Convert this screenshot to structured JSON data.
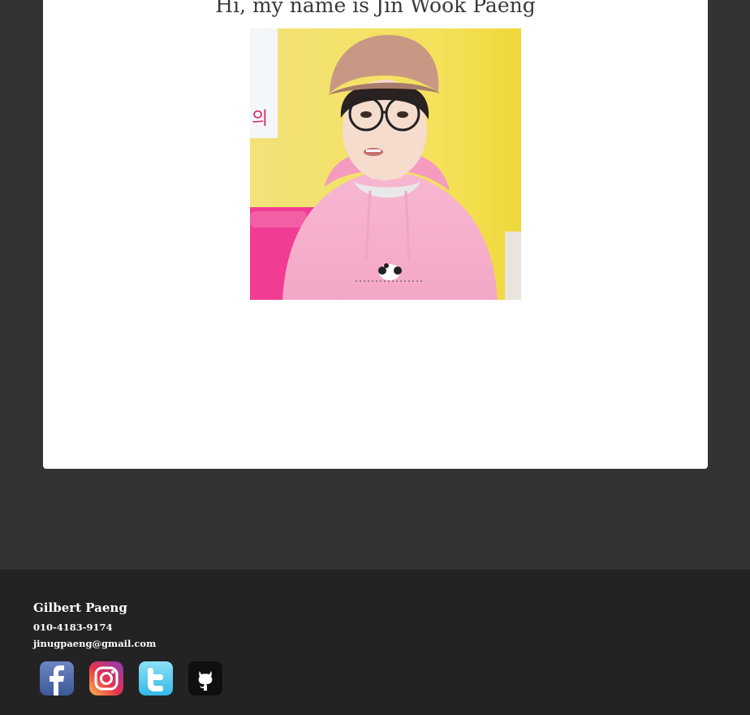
{
  "profile": {
    "heading": "Hi, my name is Jin Wook Paeng",
    "photo_alt": "Profile photo"
  },
  "footer": {
    "name": "Gilbert Paeng",
    "phone": "010-4183-9174",
    "email": "jinugpaeng@gmail.com"
  },
  "social": [
    {
      "name": "facebook",
      "icon": "facebook-icon"
    },
    {
      "name": "instagram",
      "icon": "instagram-icon"
    },
    {
      "name": "twitter",
      "icon": "twitter-icon"
    },
    {
      "name": "github",
      "icon": "github-icon"
    }
  ],
  "colors": {
    "page_bg": "#333333",
    "footer_bg": "#232323",
    "card_bg": "#ffffff",
    "heading": "#3a3a3a"
  }
}
